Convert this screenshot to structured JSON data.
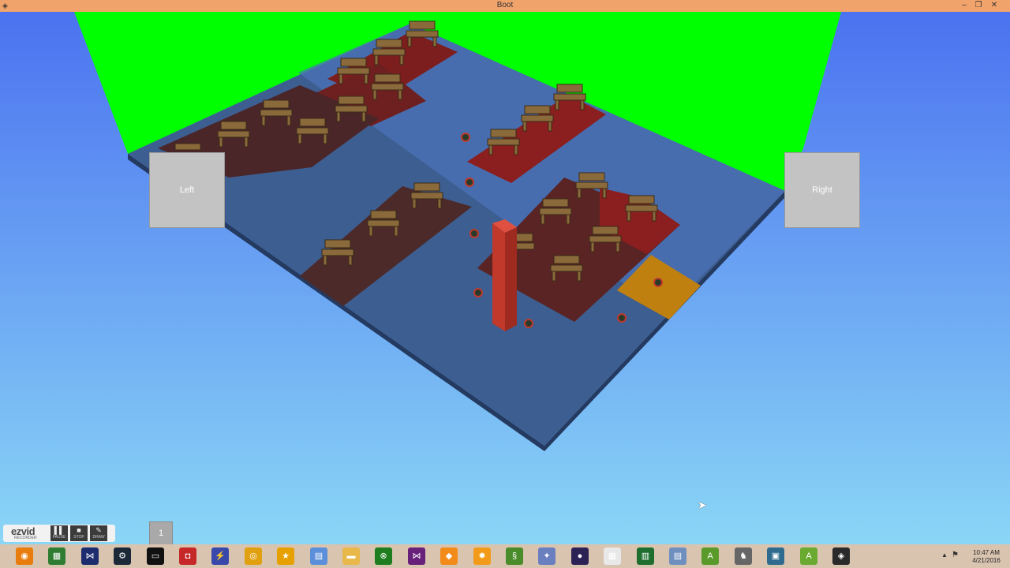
{
  "window": {
    "title": "Boot",
    "min_glyph": "–",
    "max_glyph": "❐",
    "close_glyph": "✕",
    "app_glyph": "◈"
  },
  "scene": {
    "left_label": "Left",
    "right_label": "Right",
    "colors": {
      "sky_top": "#4d74f0",
      "sky_bottom": "#86d3f6",
      "backdrop": "#00ff00",
      "floor": "#3d5e90",
      "carpet_red": "#7d1e1e",
      "goal": "#c08010",
      "pillar": "#c0392b"
    }
  },
  "page_button": {
    "label": "1"
  },
  "recorder": {
    "logo": "ezvid",
    "logo_sub": "RECORDER",
    "buttons": [
      {
        "glyph": "▌▌",
        "label": "PAUSE"
      },
      {
        "glyph": "■",
        "label": "STOP"
      },
      {
        "glyph": "✎",
        "label": "DRAW"
      }
    ]
  },
  "taskbar": {
    "apps": [
      {
        "name": "blender-icon",
        "glyph": "◉",
        "color": "#e87d0d"
      },
      {
        "name": "film-icon",
        "glyph": "▦",
        "color": "#2e7d32"
      },
      {
        "name": "visual-studio-icon",
        "glyph": "⋈",
        "color": "#1c2c6e"
      },
      {
        "name": "steam-icon",
        "glyph": "⚙",
        "color": "#1b2838"
      },
      {
        "name": "terminal-icon",
        "glyph": "▭",
        "color": "#111111"
      },
      {
        "name": "record-icon",
        "glyph": "◘",
        "color": "#c62828"
      },
      {
        "name": "network-icon",
        "glyph": "⚡",
        "color": "#3949ab"
      },
      {
        "name": "chrome-icon",
        "glyph": "◎",
        "color": "#e0a010"
      },
      {
        "name": "picture-icon",
        "glyph": "★",
        "color": "#e6a100"
      },
      {
        "name": "document-icon",
        "glyph": "▤",
        "color": "#5b8fd9"
      },
      {
        "name": "folder-icon",
        "glyph": "▬",
        "color": "#e8b84b"
      },
      {
        "name": "xbox-icon",
        "glyph": "⊗",
        "color": "#1e7d1e"
      },
      {
        "name": "visual-studio-purple-icon",
        "glyph": "⋈",
        "color": "#68217a"
      },
      {
        "name": "box-icon",
        "glyph": "◆",
        "color": "#f28b1a"
      },
      {
        "name": "settings-gear-icon",
        "glyph": "✹",
        "color": "#f29b1a"
      },
      {
        "name": "python-icon",
        "glyph": "§",
        "color": "#4a8c2a"
      },
      {
        "name": "tools-icon",
        "glyph": "✦",
        "color": "#6a7fbf"
      },
      {
        "name": "eclipse-icon",
        "glyph": "●",
        "color": "#2c2255"
      },
      {
        "name": "calculator-icon",
        "glyph": "▦",
        "color": "#e8e8e8"
      },
      {
        "name": "spreadsheet-icon",
        "glyph": "▥",
        "color": "#1e6e2e"
      },
      {
        "name": "notepad-icon",
        "glyph": "▤",
        "color": "#6f8fbf"
      },
      {
        "name": "android-studio-icon",
        "glyph": "A",
        "color": "#5a9a2a"
      },
      {
        "name": "wolf-icon",
        "glyph": "♞",
        "color": "#666666"
      },
      {
        "name": "window-app-icon",
        "glyph": "▣",
        "color": "#2e6b8f"
      },
      {
        "name": "android-icon",
        "glyph": "A",
        "color": "#6aaa30"
      },
      {
        "name": "boot-window-icon",
        "glyph": "◈",
        "color": "#2a2a2a"
      }
    ],
    "tray_arrow": "▲",
    "tray_flag": "⚑",
    "time": "10:47 AM",
    "date": "4/21/2016"
  }
}
